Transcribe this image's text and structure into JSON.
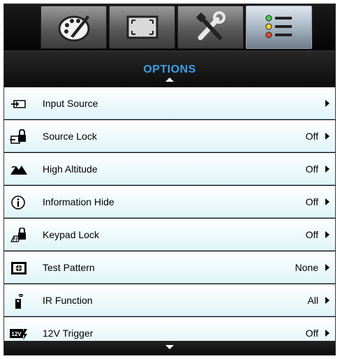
{
  "menu": {
    "title": "OPTIONS",
    "tabs": [
      {
        "icon": "palette-icon"
      },
      {
        "icon": "screen-resize-icon"
      },
      {
        "icon": "tools-icon"
      },
      {
        "icon": "options-list-icon"
      }
    ],
    "active_tab": 3,
    "accent_color": "#3aa0e8"
  },
  "items": [
    {
      "label": "Input Source",
      "value": "",
      "icon": "input-source-icon"
    },
    {
      "label": "Source Lock",
      "value": "Off",
      "icon": "source-lock-icon"
    },
    {
      "label": "High Altitude",
      "value": "Off",
      "icon": "high-altitude-icon"
    },
    {
      "label": "Information Hide",
      "value": "Off",
      "icon": "information-icon"
    },
    {
      "label": "Keypad Lock",
      "value": "Off",
      "icon": "keypad-lock-icon"
    },
    {
      "label": "Test Pattern",
      "value": "None",
      "icon": "test-pattern-icon"
    },
    {
      "label": "IR Function",
      "value": "All",
      "icon": "ir-remote-icon"
    },
    {
      "label": "12V Trigger",
      "value": "Off",
      "icon": "trigger-12v-icon",
      "icon_text": "12V"
    }
  ]
}
